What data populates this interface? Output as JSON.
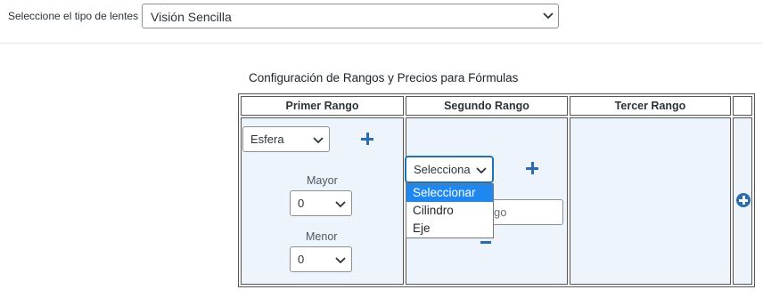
{
  "lens_type": {
    "label": "Seleccione el tipo de lentes",
    "selected": "Visión Sencilla"
  },
  "config": {
    "title": "Configuración de Rangos y Precios para Fórmulas",
    "columns": [
      "Primer Rango",
      "Segundo Rango",
      "Tercer Rango",
      ""
    ],
    "primer_rango": {
      "type_selected": "Esfera",
      "mayor_label": "Mayor",
      "mayor_value": "0",
      "menor_label": "Menor",
      "menor_value": "0"
    },
    "segundo_rango": {
      "type_selected": "Selecciona",
      "input_partial_text": "go",
      "dropdown_options": [
        "Seleccionar",
        "Cilindro",
        "Eje"
      ],
      "highlighted_option": "Seleccionar"
    }
  },
  "colors": {
    "accent": "#2b6cb0",
    "cell_bg": "#eef4fb",
    "highlight": "#1e88f0"
  },
  "icons": {
    "add": "plus-icon",
    "remove": "minus-icon",
    "add_column": "plus-circle-icon",
    "dropdown": "chevron-down-icon"
  }
}
